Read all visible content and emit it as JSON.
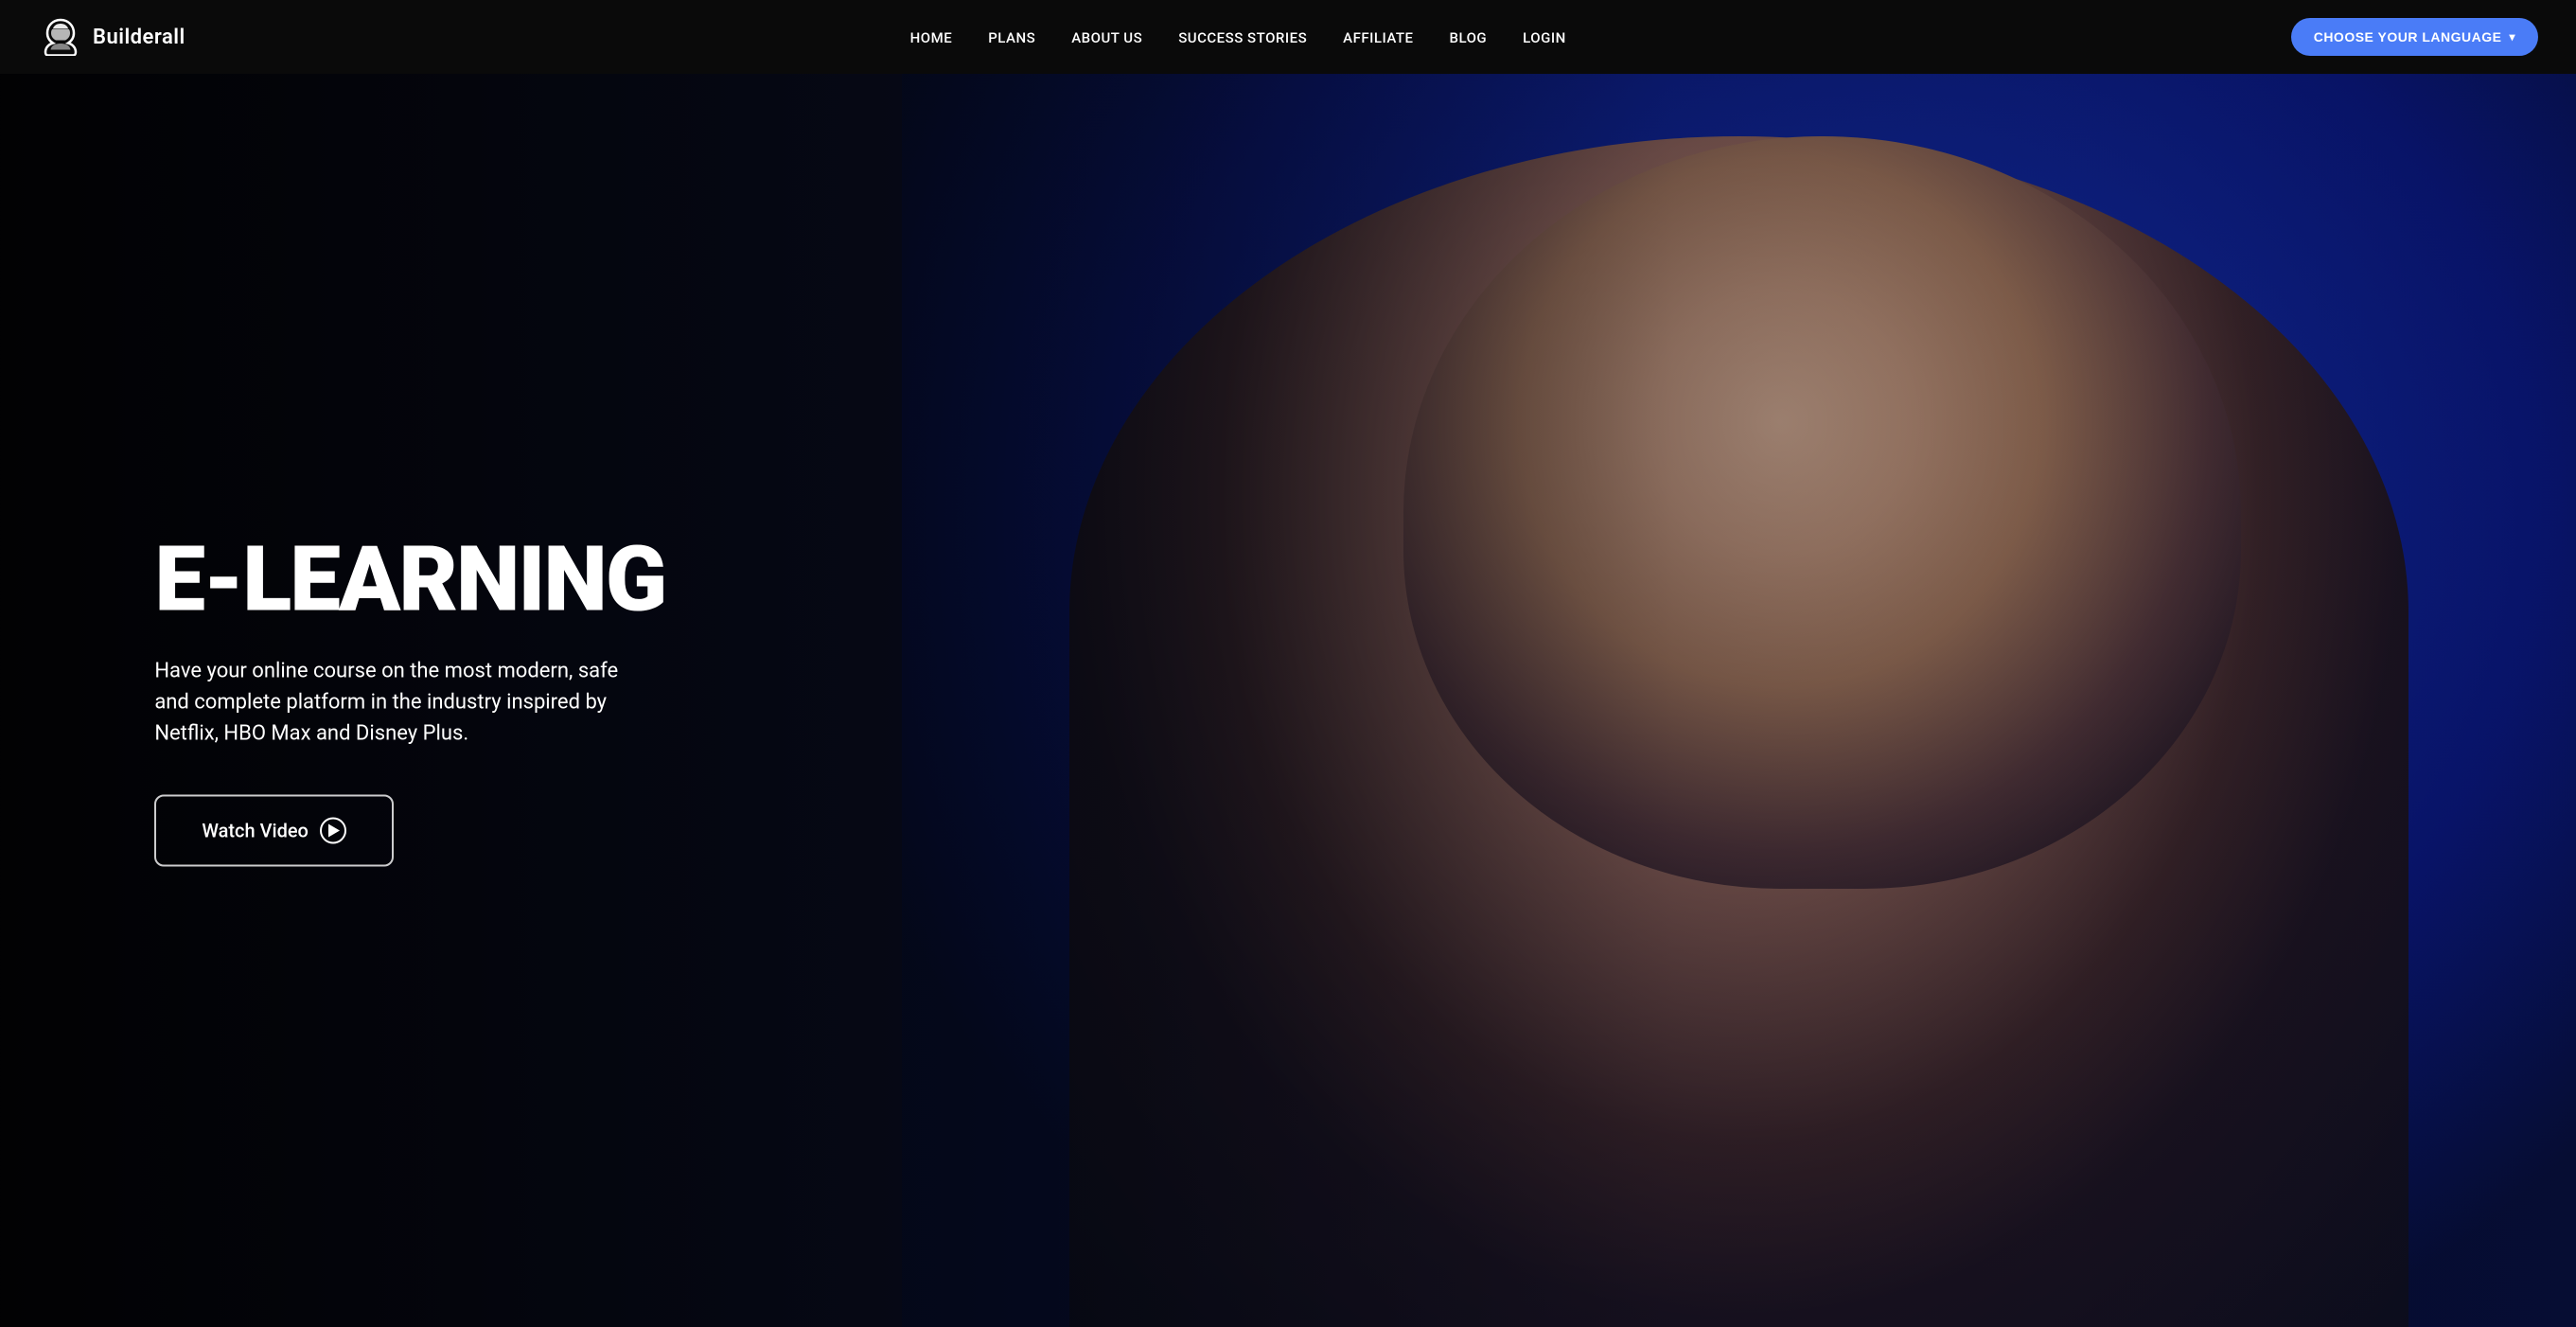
{
  "brand": {
    "name": "Builderall",
    "logo_alt": "Builderall logo"
  },
  "nav": {
    "links": [
      {
        "label": "HOME",
        "href": "#"
      },
      {
        "label": "PLANS",
        "href": "#"
      },
      {
        "label": "ABOUT US",
        "href": "#"
      },
      {
        "label": "SUCCESS STORIES",
        "href": "#"
      },
      {
        "label": "AFFILIATE",
        "href": "#"
      },
      {
        "label": "BLOG",
        "href": "#"
      },
      {
        "label": "LOGIN",
        "href": "#"
      }
    ],
    "cta_label": "CHOOSE YOUR LANGUAGE",
    "cta_chevron": "▾"
  },
  "hero": {
    "title": "E-LEARNING",
    "subtitle": "Have your online course on the most modern, safe and complete platform in the industry inspired by Netflix, HBO Max and Disney Plus.",
    "watch_button_label": "Watch Video",
    "colors": {
      "accent_blue": "#4a7cf7",
      "background": "#0a0a14"
    }
  }
}
